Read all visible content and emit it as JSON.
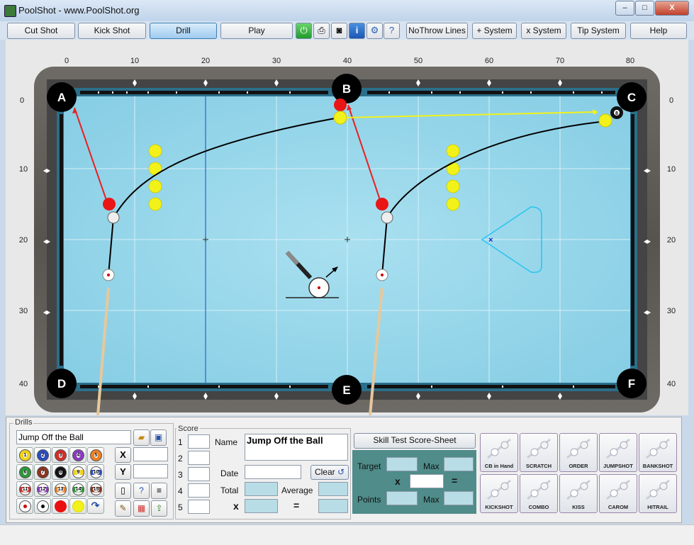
{
  "window": {
    "title": "PoolShot - www.PoolShot.org",
    "min": "–",
    "max": "□",
    "close": "X"
  },
  "toolbar": {
    "cut_shot": "Cut Shot",
    "kick_shot": "Kick Shot",
    "drill": "Drill",
    "play": "Play",
    "no_throw": "NoThrow Lines",
    "plus_system": "+ System",
    "x_system": "x System",
    "tip_system": "Tip System",
    "help": "Help"
  },
  "table": {
    "x_ruler": [
      "0",
      "10",
      "20",
      "30",
      "40",
      "50",
      "60",
      "70",
      "80"
    ],
    "y_ruler": [
      "0",
      "10",
      "20",
      "30",
      "40"
    ],
    "pockets": [
      "A",
      "B",
      "C",
      "D",
      "E",
      "F"
    ],
    "cue_ball_marker": "8"
  },
  "drills": {
    "group_label": "Drills",
    "current": "Jump Off the Ball",
    "x_label": "X",
    "y_label": "Y",
    "x_value": "",
    "y_value": "",
    "balls": [
      {
        "n": "1",
        "color": "#f0d21a"
      },
      {
        "n": "2",
        "color": "#2a4cbf"
      },
      {
        "n": "3",
        "color": "#d0302a"
      },
      {
        "n": "4",
        "color": "#8a3ac0"
      },
      {
        "n": "5",
        "color": "#ee8020"
      },
      {
        "n": "6",
        "color": "#2a9a3a"
      },
      {
        "n": "7",
        "color": "#8a3520"
      },
      {
        "n": "8",
        "color": "#111111"
      },
      {
        "n": "9",
        "color": "#f0d21a"
      },
      {
        "n": "10",
        "color": "#2a4cbf"
      },
      {
        "n": "11",
        "color": "#d0302a"
      },
      {
        "n": "12",
        "color": "#8a3ac0"
      },
      {
        "n": "13",
        "color": "#ee8020"
      },
      {
        "n": "14",
        "color": "#2a9a3a"
      },
      {
        "n": "15",
        "color": "#8a3520"
      }
    ]
  },
  "score": {
    "group_label": "Score",
    "rows": [
      "1",
      "2",
      "3",
      "4",
      "5"
    ],
    "name_label": "Name",
    "name_value": "Jump Off the Ball",
    "date_label": "Date",
    "date_value": "",
    "clear": "Clear",
    "total_label": "Total",
    "average_label": "Average",
    "x_label": "x",
    "eq_label": "="
  },
  "skill": {
    "sheet_button": "Skill Test Score-Sheet",
    "target_label": "Target",
    "max_label": "Max",
    "x_label": "x",
    "eq_label": "=",
    "points_label": "Points",
    "max2_label": "Max"
  },
  "shot_types": [
    "CB in Hand",
    "SCRATCH",
    "ORDER",
    "JUMPSHOT",
    "BANKSHOT",
    "KICKSHOT",
    "COMBO",
    "KISS",
    "CAROM",
    "HITRAIL"
  ]
}
